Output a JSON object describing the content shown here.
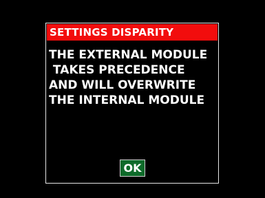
{
  "dialog": {
    "title": "SETTINGS DISPARITY",
    "message_lines": [
      "THE EXTERNAL MODULE",
      " TAKES PRECEDENCE",
      "AND WILL OVERWRITE",
      "THE INTERNAL MODULE"
    ],
    "ok_label": "OK"
  },
  "colors": {
    "background": "#000000",
    "title_bar": "#f20d0d",
    "button": "#0e6b2a",
    "text": "#ffffff",
    "border": "#e6e6e6"
  }
}
